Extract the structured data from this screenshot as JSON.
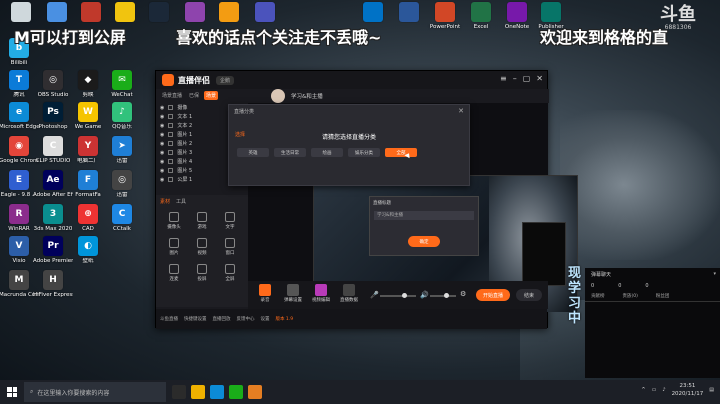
{
  "marquee": {
    "left": "M可以打到公屏",
    "mid": "喜欢的话点个关注走不丢哦~",
    "right": "欢迎来到格格的直"
  },
  "corner_logo": {
    "mark": "斗鱼",
    "id": "6881306"
  },
  "desktop": {
    "col1": [
      {
        "label": "Bilibili",
        "color": "#23ade5",
        "glyph": "b",
        "icon": "bilibili-icon"
      },
      {
        "label": "腾讯",
        "color": "#0b7bd8",
        "glyph": "T",
        "icon": "tencent-icon"
      },
      {
        "label": "Microsoft Edge",
        "color": "#0c8bd6",
        "glyph": "e",
        "icon": "edge-icon"
      },
      {
        "label": "Google Chrome",
        "color": "#e3453a",
        "glyph": "◉",
        "icon": "chrome-icon"
      },
      {
        "label": "Eagle - 9.8 ...",
        "color": "#2f5fd0",
        "glyph": "E",
        "icon": "eagle-icon"
      },
      {
        "label": "WinRAR",
        "color": "#8b2c8c",
        "glyph": "R",
        "icon": "winrar-icon"
      },
      {
        "label": "Visio",
        "color": "#2c5ea8",
        "glyph": "V",
        "icon": "visio-icon"
      },
      {
        "label": "Macrunda Comp",
        "color": "#444",
        "glyph": "M",
        "icon": "app-icon"
      }
    ],
    "col2": [
      {
        "label": "OBS Studio",
        "color": "#302e31",
        "glyph": "◎",
        "icon": "obs-icon"
      },
      {
        "label": "Photoshop",
        "color": "#001e36",
        "glyph": "Ps",
        "icon": "photoshop-icon"
      },
      {
        "label": "CLIP STUDIO",
        "color": "#ddd",
        "glyph": "C",
        "icon": "clip-studio-icon"
      },
      {
        "label": "Adobe After Effects 2020",
        "color": "#00005b",
        "glyph": "Ae",
        "icon": "after-effects-icon"
      },
      {
        "label": "3ds Max 2020",
        "color": "#0a8e8f",
        "glyph": "3",
        "icon": "3dsmax-icon"
      },
      {
        "label": "Adobe Premiere",
        "color": "#00005b",
        "glyph": "Pr",
        "icon": "premiere-icon"
      },
      {
        "label": "HiFiver Express",
        "color": "#444",
        "glyph": "H",
        "icon": "app-icon"
      }
    ],
    "col3": [
      {
        "label": "剪映",
        "color": "#1b1b1b",
        "glyph": "◆",
        "icon": "jianying-icon"
      },
      {
        "label": "We Game",
        "color": "#f5c400",
        "glyph": "W",
        "icon": "wegame-icon"
      },
      {
        "label": "电脑二厂",
        "color": "#c33",
        "glyph": "Y",
        "icon": "app-icon"
      },
      {
        "label": "FormatFa",
        "color": "#1f7fd6",
        "glyph": "F",
        "icon": "format-icon"
      },
      {
        "label": "CAD",
        "color": "#e33",
        "glyph": "⊕",
        "icon": "cad-icon"
      },
      {
        "label": "壁纸",
        "color": "#0095da",
        "glyph": "◐",
        "icon": "wallpaper-icon"
      }
    ],
    "col4": [
      {
        "label": "WeChat",
        "color": "#1aad19",
        "glyph": "✉",
        "icon": "wechat-icon"
      },
      {
        "label": "QQ音乐",
        "color": "#31c27c",
        "glyph": "♪",
        "icon": "qqmusic-icon"
      },
      {
        "label": "迅雷",
        "color": "#1f7fd6",
        "glyph": "➤",
        "icon": "thunder-icon"
      },
      {
        "label": "迅雷",
        "color": "#444",
        "glyph": "◎",
        "icon": "app-icon"
      },
      {
        "label": "CCtalk",
        "color": "#1e88e5",
        "glyph": "C",
        "icon": "cctalk-icon"
      }
    ],
    "top_row": [
      {
        "label": "",
        "color": "#cfd8dc",
        "icon": "app-icon"
      },
      {
        "label": "",
        "color": "#4a90e2",
        "icon": "app-icon"
      },
      {
        "label": "",
        "color": "#c0392b",
        "icon": "app-icon"
      },
      {
        "label": "",
        "color": "#f1c40f",
        "icon": "app-icon"
      },
      {
        "label": "",
        "color": "#1b2838",
        "icon": "steam-icon"
      },
      {
        "label": "",
        "color": "#8e44ad",
        "icon": "app-icon"
      },
      {
        "label": "",
        "color": "#f39c12",
        "icon": "folder-icon"
      },
      {
        "label": "",
        "color": "#4b53bc",
        "icon": "teams-icon"
      },
      {
        "label": "",
        "color": "#0072c6",
        "icon": "outlook-icon"
      },
      {
        "label": "",
        "color": "#2b579a",
        "icon": "word-icon"
      },
      {
        "label": "PowerPoint",
        "color": "#d24726",
        "icon": "powerpoint-icon"
      },
      {
        "label": "Excel",
        "color": "#217346",
        "icon": "excel-icon"
      },
      {
        "label": "OneNote",
        "color": "#7719aa",
        "icon": "onenote-icon"
      },
      {
        "label": "Publisher",
        "color": "#077568",
        "icon": "publisher-icon"
      }
    ]
  },
  "app": {
    "name": "直播伴侣",
    "badge": "企鹅",
    "tabs": [
      "场景直播",
      "已保",
      "场景"
    ],
    "scenes": [
      "摄像",
      "文本 1",
      "文本 2",
      "图片 1",
      "图片 2",
      "图片 3",
      "图片 4",
      "图片 5",
      "公屏 1"
    ],
    "room_title": "学习&和主播",
    "source_tabs": [
      "素材",
      "工具"
    ],
    "sources": [
      "摄像头",
      "游戏",
      "文字",
      "图片",
      "视频",
      "窗口",
      "连麦",
      "投屏",
      "全屏"
    ],
    "toolbar": [
      {
        "label": "录音",
        "icon": "record-icon"
      },
      {
        "label": "弹幕设置",
        "icon": "danmaku-icon"
      },
      {
        "label": "视频编辑",
        "icon": "video-edit-icon"
      },
      {
        "label": "直播数据",
        "icon": "data-icon"
      }
    ],
    "start_label": "开始直播",
    "end_label": "结束",
    "footer": [
      "斗鱼直播",
      "快捷键设置",
      "直播回放",
      "反馈中心",
      "设置"
    ],
    "footer_hi": "版本 1.9"
  },
  "modal": {
    "header": "直播分类",
    "close": "✕",
    "category": "选择",
    "prompt": "请猜您选择直播分类",
    "options": [
      "英雄",
      "生活日常",
      "绘画",
      "娱乐分类",
      "全部"
    ]
  },
  "nested": {
    "dialog_title": "直播标题",
    "input_value": "学习&和主播",
    "ok_label": "确定"
  },
  "chat": {
    "title": "弹幕聊天",
    "stats": [
      "0",
      "0",
      "0"
    ],
    "columns": [
      "贡献榜",
      "贵族(0)",
      "粉丝团"
    ],
    "caret": "▾"
  },
  "vertical_text": "现学习中",
  "taskbar": {
    "search_placeholder": "在这里输入你要搜索的内容",
    "icons": [
      {
        "color": "#2b2b2b",
        "icon": "task-view-icon"
      },
      {
        "color": "#f0b100",
        "icon": "file-explorer-icon"
      },
      {
        "color": "#0c8bd6",
        "icon": "edge-icon"
      },
      {
        "color": "#1aad19",
        "icon": "chrome-icon"
      },
      {
        "color": "#e67e22",
        "icon": "live-app-icon"
      }
    ],
    "time": "23:51",
    "date": "2020/11/17"
  }
}
